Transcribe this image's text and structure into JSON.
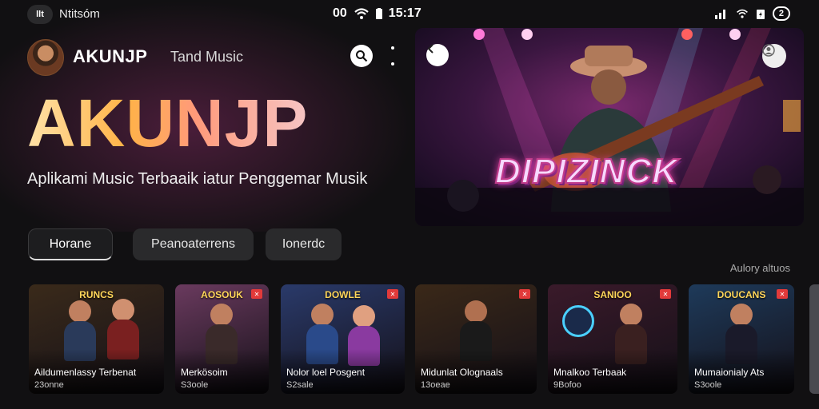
{
  "status_bar": {
    "left_badge": "llt",
    "app_label": "Ntitsóm",
    "center_text": "00",
    "time": "15:17",
    "battery_pill": "2"
  },
  "header": {
    "brand": "AKUNJP",
    "tagline": "Tand Music",
    "avatar": "user-avatar"
  },
  "hero": {
    "title": "AKUNJP",
    "subtitle": "Aplikami Music Terbaaik iatur Penggemar Musik"
  },
  "banner": {
    "title": "DIPIZINCK",
    "colors": {
      "bg": "#1a0f25",
      "accent": "#ff4ab8"
    }
  },
  "tabs": [
    {
      "label": "Horane",
      "active": true
    },
    {
      "label": "Peanoaterrens",
      "active": false
    },
    {
      "label": "Ionerdc",
      "active": false
    }
  ],
  "see_all": "Aulory altuos",
  "cards": [
    {
      "top": "RUNCS",
      "title": "Aildumenlassy Terbenat",
      "meta": "23onne",
      "bg": "#3a2a1a"
    },
    {
      "top": "AOSOUK",
      "title": "Merkösoim",
      "meta": "S3oole",
      "bg": "#6a3a5e"
    },
    {
      "top": "DOWLE",
      "title": "Nolor loel Posgent",
      "meta": "S2sale",
      "bg": "#2a3a6a"
    },
    {
      "top": "",
      "title": "Midunlat Olognaals",
      "meta": "13oeae",
      "bg": "#3a2818"
    },
    {
      "top": "SANIOO",
      "title": "Mnalkoo Terbaak",
      "meta": "9Bofoo",
      "bg": "#3a1a2a"
    },
    {
      "top": "DOUCANS",
      "title": "Mumaionialy Ats",
      "meta": "S3oole",
      "bg": "#1e3a5a"
    }
  ]
}
